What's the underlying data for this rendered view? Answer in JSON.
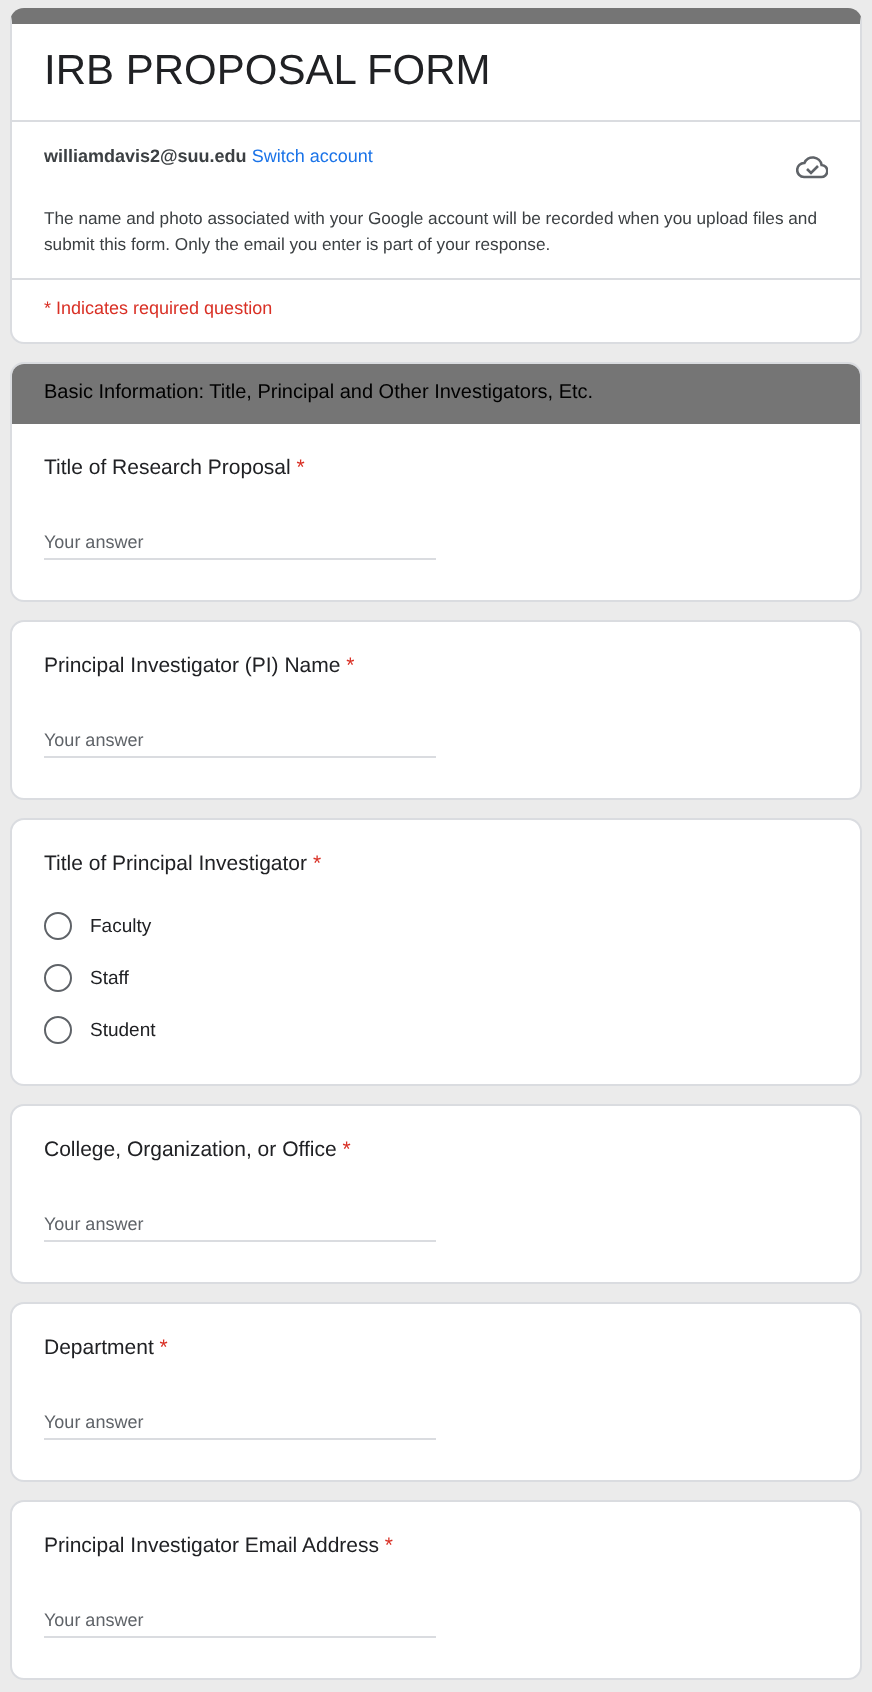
{
  "form": {
    "title": "IRB PROPOSAL FORM",
    "account": {
      "email": "williamdavis2@suu.edu",
      "switch_link": "Switch account"
    },
    "notice": "The name and photo associated with your Google account will be recorded when you upload files and submit this form. Only the email you enter is part of your response.",
    "required_note": "* Indicates required question"
  },
  "section": {
    "title": "Basic Information: Title, Principal and Other Investigators, Etc."
  },
  "questions": [
    {
      "kind": "text",
      "label": "Title of Research Proposal",
      "mark": "*",
      "placeholder": "Your answer"
    },
    {
      "kind": "text",
      "label": "Principal Investigator (PI) Name",
      "mark": "*",
      "placeholder": "Your answer"
    },
    {
      "kind": "radio",
      "label": "Title of Principal Investigator",
      "mark": "*",
      "options": [
        {
          "label": "Faculty",
          "selected": false
        },
        {
          "label": "Staff",
          "selected": false
        },
        {
          "label": "Student",
          "selected": false
        }
      ]
    },
    {
      "kind": "text",
      "label": "College, Organization, or Office",
      "mark": "*",
      "placeholder": "Your answer"
    },
    {
      "kind": "text",
      "label": "Department",
      "mark": "*",
      "placeholder": "Your answer"
    },
    {
      "kind": "text",
      "label": "Principal Investigator Email Address",
      "mark": "*",
      "placeholder": "Your answer"
    }
  ]
}
